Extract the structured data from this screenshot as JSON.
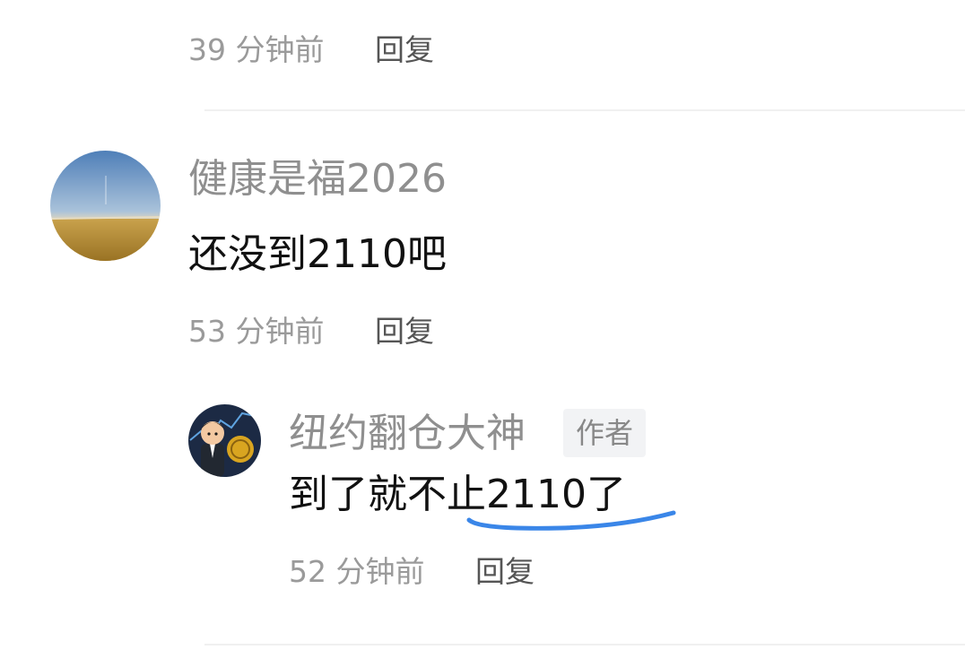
{
  "comments": [
    {
      "time": "39 分钟前",
      "reply_label": "回复"
    },
    {
      "username": "健康是福2026",
      "content": "还没到2110吧",
      "time": "53 分钟前",
      "reply_label": "回复",
      "avatar_icon": "landscape-avatar-icon",
      "replies": [
        {
          "username": "纽约翻仓大神",
          "badge": "作者",
          "content_before": "到了就不",
          "content_underlined": "止2110了",
          "time": "52 分钟前",
          "reply_label": "回复",
          "avatar_icon": "cartoon-man-avatar-icon"
        }
      ]
    }
  ],
  "colors": {
    "underline_annotation": "#3a86e8",
    "username": "#8f8f8f",
    "timestamp": "#9a9a9a",
    "reply": "#555555",
    "badge_bg": "#f2f3f5"
  }
}
